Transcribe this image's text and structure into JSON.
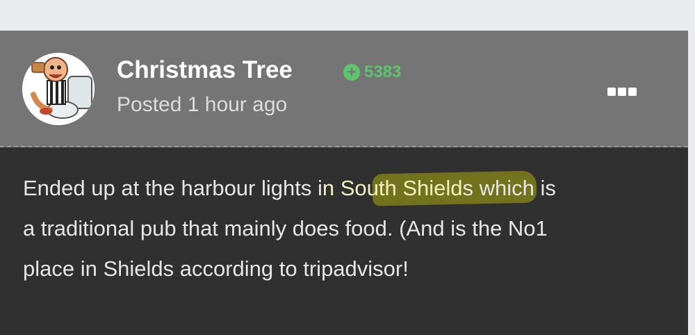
{
  "post": {
    "author": "Christmas Tree",
    "reputation": "5383",
    "reputation_icon": "plus-circle-icon",
    "posted": "Posted 1 hour ago",
    "menu_icon": "more-options-icon",
    "highlight_color": "#8a8a18",
    "content": {
      "line1_before": "Ended up at the harbour lights i",
      "line1_highlight": "n South Shield",
      "line1_after": "s which is",
      "line2": "a traditional pub that mainly does food. (And is the No1",
      "line3": "place in Shields according to tripadvisor!"
    }
  }
}
